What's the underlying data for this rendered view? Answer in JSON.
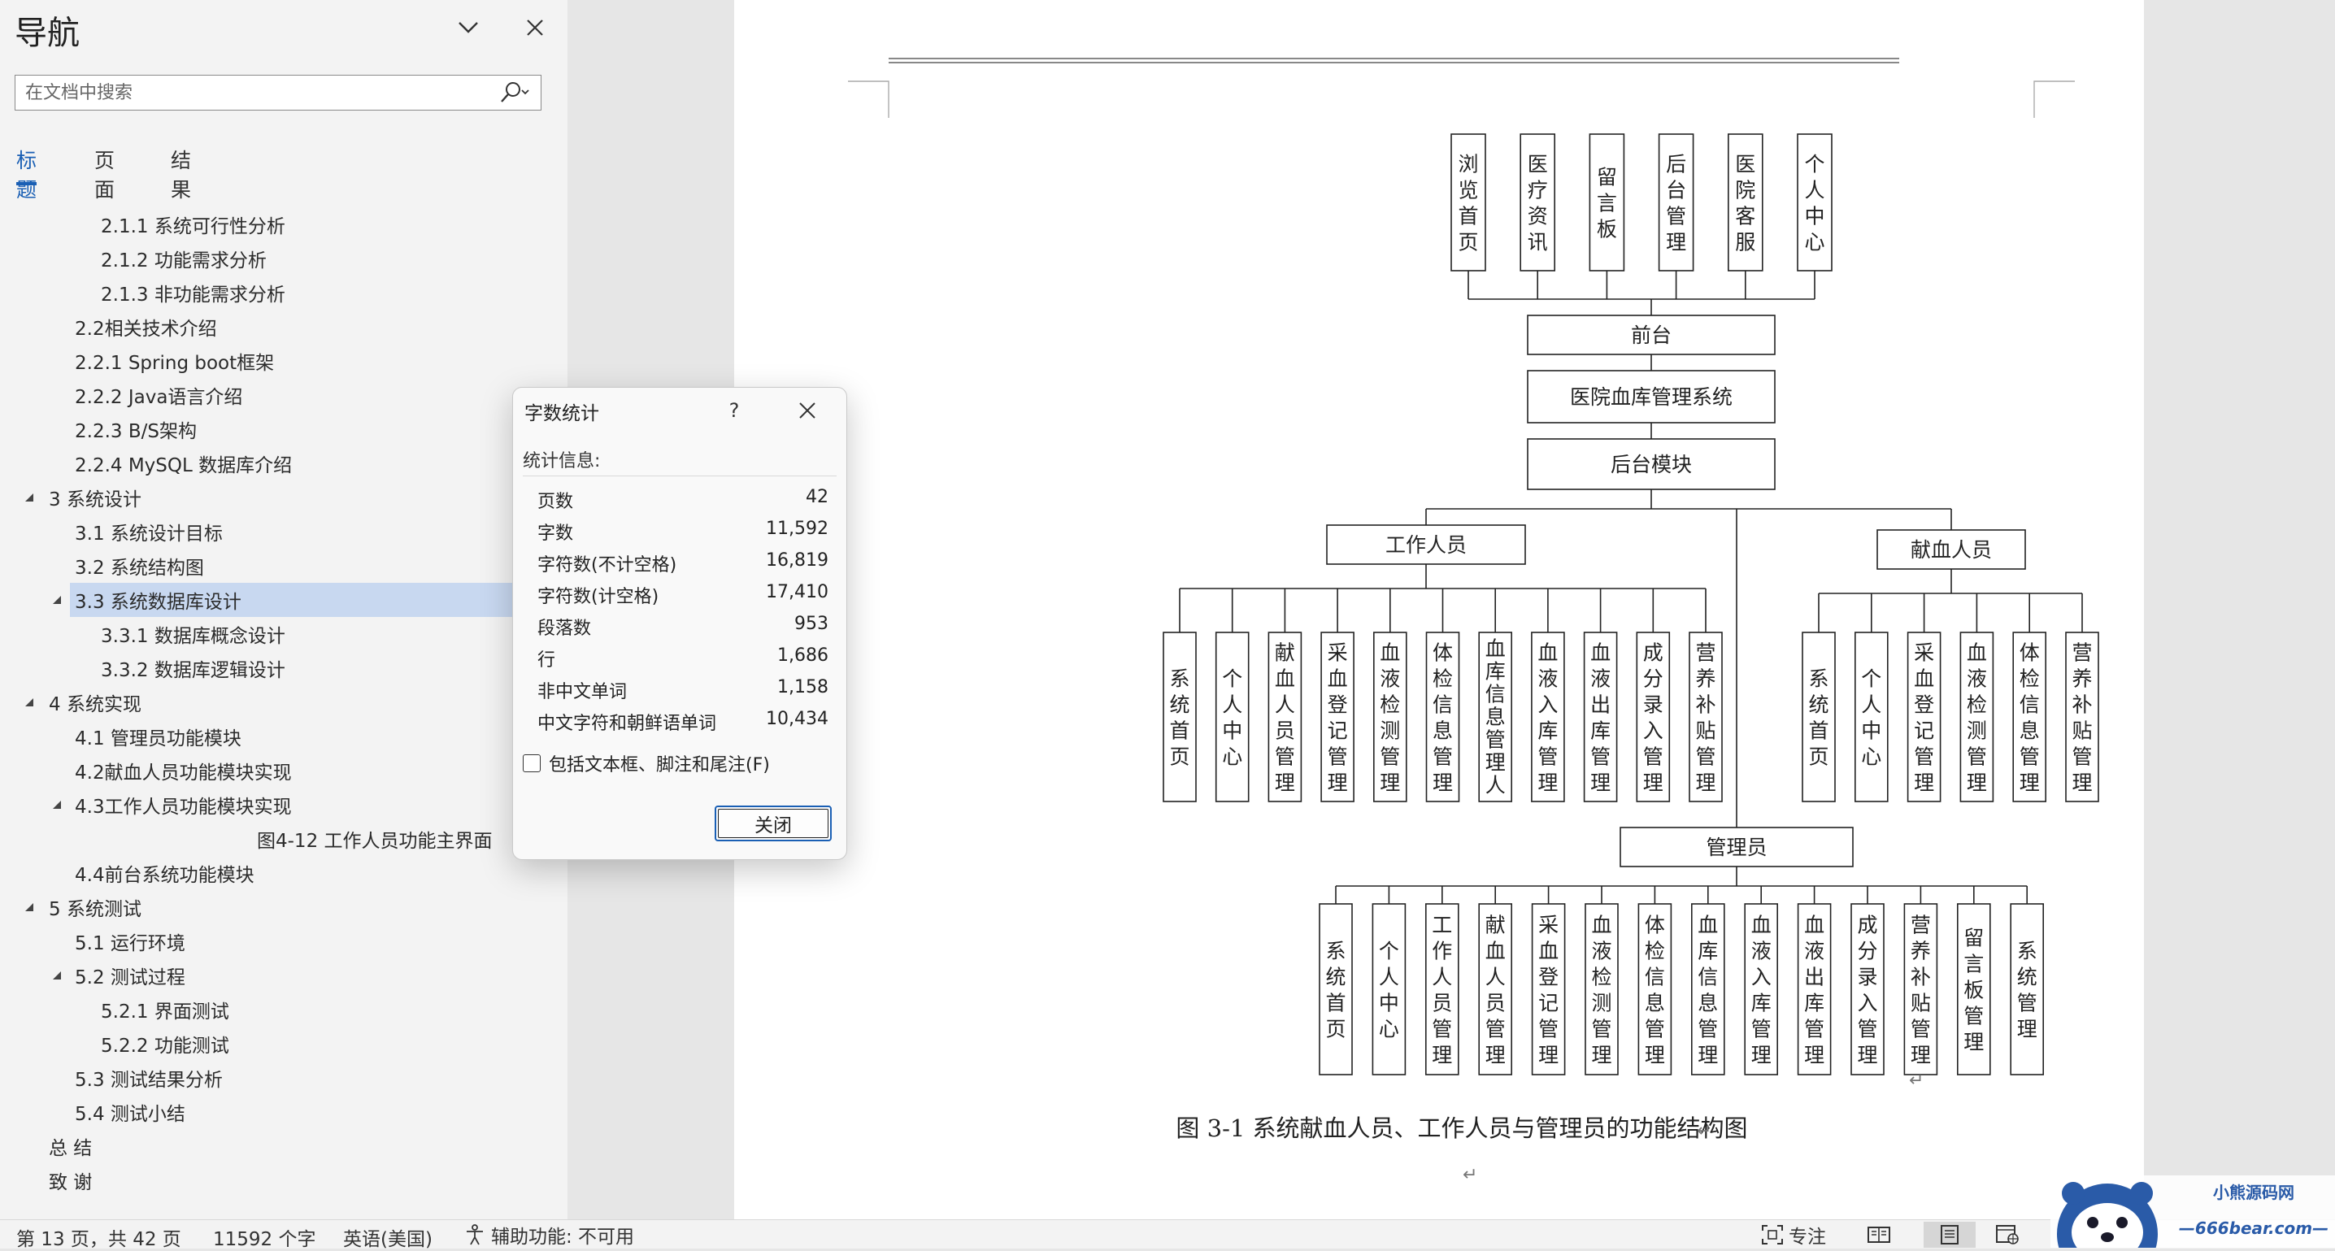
{
  "nav": {
    "title": "导航",
    "search_placeholder": "在文档中搜索",
    "tabs": [
      {
        "label": "标题",
        "active": true
      },
      {
        "label": "页面",
        "active": false
      },
      {
        "label": "结果",
        "active": false
      }
    ],
    "outline": [
      {
        "label": "2.1.1 系统可行性分析",
        "level": 3
      },
      {
        "label": "2.1.2 功能需求分析",
        "level": 3
      },
      {
        "label": "2.1.3 非功能需求分析",
        "level": 3
      },
      {
        "label": "2.2相关技术介绍",
        "level": 2
      },
      {
        "label": "2.2.1 Spring boot框架",
        "level": 2
      },
      {
        "label": "2.2.2 Java语言介绍",
        "level": 2
      },
      {
        "label": "2.2.3 B/S架构",
        "level": 2
      },
      {
        "label": "2.2.4 MySQL 数据库介绍",
        "level": 2
      },
      {
        "label": "3 系统设计",
        "level": 1,
        "expanded": true
      },
      {
        "label": "3.1 系统设计目标",
        "level": 2
      },
      {
        "label": "3.2 系统结构图",
        "level": 2
      },
      {
        "label": "3.3 系统数据库设计",
        "level": 2,
        "expanded": true,
        "selected": true
      },
      {
        "label": "3.3.1 数据库概念设计",
        "level": 3
      },
      {
        "label": "3.3.2 数据库逻辑设计",
        "level": 3
      },
      {
        "label": "4 系统实现",
        "level": 1,
        "expanded": true
      },
      {
        "label": "4.1  管理员功能模块",
        "level": 2
      },
      {
        "label": "4.2献血人员功能模块实现",
        "level": 2
      },
      {
        "label": "4.3工作人员功能模块实现",
        "level": 2,
        "expanded": true
      },
      {
        "label": "图4-12 工作人员功能主界面",
        "level": 4
      },
      {
        "label": "4.4前台系统功能模块",
        "level": 2
      },
      {
        "label": "5 系统测试",
        "level": 1,
        "expanded": true
      },
      {
        "label": "5.1 运行环境",
        "level": 2
      },
      {
        "label": "5.2 测试过程",
        "level": 2,
        "expanded": true
      },
      {
        "label": "5.2.1 界面测试",
        "level": 3
      },
      {
        "label": "5.2.2 功能测试",
        "level": 3
      },
      {
        "label": "5.3 测试结果分析",
        "level": 2
      },
      {
        "label": "5.4 测试小结",
        "level": 2
      },
      {
        "label": "总 结",
        "level": 1
      },
      {
        "label": "致 谢",
        "level": 1
      }
    ]
  },
  "dialog": {
    "title": "字数统计",
    "help": "?",
    "section": "统计信息:",
    "stats": [
      {
        "label": "页数",
        "value": "42"
      },
      {
        "label": "字数",
        "value": "11,592"
      },
      {
        "label": "字符数(不计空格)",
        "value": "16,819"
      },
      {
        "label": "字符数(计空格)",
        "value": "17,410"
      },
      {
        "label": "段落数",
        "value": "953"
      },
      {
        "label": "行",
        "value": "1,686"
      },
      {
        "label": "非中文单词",
        "value": "1,158"
      },
      {
        "label": "中文字符和朝鲜语单词",
        "value": "10,434"
      }
    ],
    "checkbox_label": "包括文本框、脚注和尾注(F)",
    "checkbox_checked": false,
    "close_label": "关闭"
  },
  "diagram": {
    "front_items": [
      "浏览首页",
      "医疗资讯",
      "留言板",
      "后台管理",
      "医院客服",
      "个人中心"
    ],
    "front": "前台",
    "system": "医院血库管理系统",
    "backend": "后台模块",
    "staff": "工作人员",
    "staff_items": [
      "系统首页",
      "个人中心",
      "献血人员管理",
      "采血登记管理",
      "血液检测管理",
      "体检信息管理",
      "血库信息管理人",
      "血液入库管理",
      "血液出库管理",
      "成分录入管理",
      "营养补贴管理"
    ],
    "donor": "献血人员",
    "donor_items": [
      "系统首页",
      "个人中心",
      "采血登记管理",
      "血液检测管理",
      "体检信息管理",
      "营养补贴管理"
    ],
    "admin": "管理员",
    "admin_items": [
      "系统首页",
      "个人中心",
      "工作人员管理",
      "献血人员管理",
      "采血登记管理",
      "血液检测管理",
      "体检信息管理",
      "血库信息管理",
      "血液入库管理",
      "血液出库管理",
      "成分录入管理",
      "营养补贴管理",
      "留言板管理",
      "系统管理"
    ],
    "caption": "图 3-1  系统献血人员、工作人员与管理员的功能结构图"
  },
  "status": {
    "page": "第 13 页，共 42 页",
    "words": "11592 个字",
    "language": "英语(美国)",
    "accessibility": "辅助功能: 不可用",
    "focus": "专注"
  },
  "logo": {
    "line1": "小熊源码网",
    "line2": "—666bear.com—"
  }
}
